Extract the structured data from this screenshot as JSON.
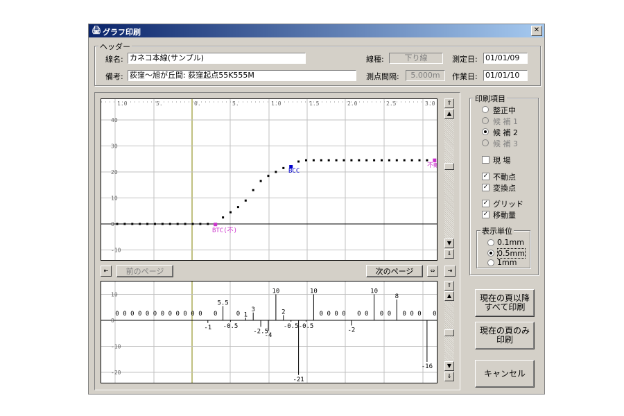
{
  "window": {
    "title": "グラフ印刷",
    "close_symbol": "✕"
  },
  "header": {
    "group_title": "ヘッダー",
    "line_name_label": "線名:",
    "line_name_value": "カネコ本線(サンプル)",
    "line_type_label": "線種:",
    "line_type_value": "下り線",
    "measure_date_label": "測定日:",
    "measure_date_value": "01/01/09",
    "remarks_label": "備考:",
    "remarks_value": "荻窪〜旭が丘間: 荻窪起点55K555M",
    "interval_label": "測点間隔:",
    "interval_value": "5.000m",
    "work_date_label": "作業日:",
    "work_date_value": "01/01/10"
  },
  "upper_chart": {
    "x_ticks": [
      "1.0",
      "5.",
      "0.",
      "5.",
      "1.0",
      "1.5",
      "2.0",
      "2.5",
      "3.0"
    ],
    "y_ticks": [
      "40",
      "30",
      "20",
      "10",
      "0",
      "-10"
    ],
    "label_btc": "BTC(不)",
    "label_bcc": "BCC",
    "label_fudou": "不動",
    "btc_color": "#cc33cc",
    "bcc_color": "#0000cc",
    "points": [
      0,
      0,
      0,
      0,
      0,
      0,
      0,
      0,
      0,
      0,
      0,
      0,
      0,
      -0.2,
      2.5,
      4.5,
      6.5,
      9,
      13,
      16.5,
      18.5,
      20,
      21.5,
      22,
      24,
      24.5,
      24.5,
      24.5,
      24.5,
      24.5,
      24.5,
      24.5,
      24.5,
      24.5,
      24.5,
      24.5,
      24.5,
      24.5,
      24.5,
      24.5,
      24.5,
      24.5,
      24.5,
      24.5
    ]
  },
  "lower_chart": {
    "y_ticks": [
      "10",
      "0",
      "-10",
      "-20"
    ],
    "values": [
      0,
      0,
      0,
      0,
      0,
      0,
      0,
      0,
      0,
      0,
      0,
      0,
      -1,
      0,
      5.5,
      -0.5,
      0,
      1,
      3,
      -2.5,
      -4,
      10,
      2,
      -0.5,
      -21,
      -0.5,
      10,
      0,
      0,
      0,
      0,
      -2,
      0,
      0,
      10,
      0,
      0,
      8,
      0,
      0,
      0,
      -16,
      0
    ]
  },
  "nav": {
    "prev_page": "前のページ",
    "next_page": "次のページ"
  },
  "print_items": {
    "group_title": "印刷項目",
    "seisei": "整正中",
    "kouho1": "候 補 1",
    "kouho2": "候 補 2",
    "kouho3": "候 補 3",
    "genba": "現 場",
    "fudouten": "不動点",
    "henkanten": "変換点",
    "grid": "グリッド",
    "idouryou": "移動量"
  },
  "units": {
    "group_title": "表示単位",
    "u01": "0.1mm",
    "u05": "0.5mm",
    "u1": "1mm"
  },
  "buttons": {
    "print_after": "現在の頁以降\nすべて印刷",
    "print_current": "現在の頁のみ\n印刷",
    "cancel": "キャンセル"
  }
}
